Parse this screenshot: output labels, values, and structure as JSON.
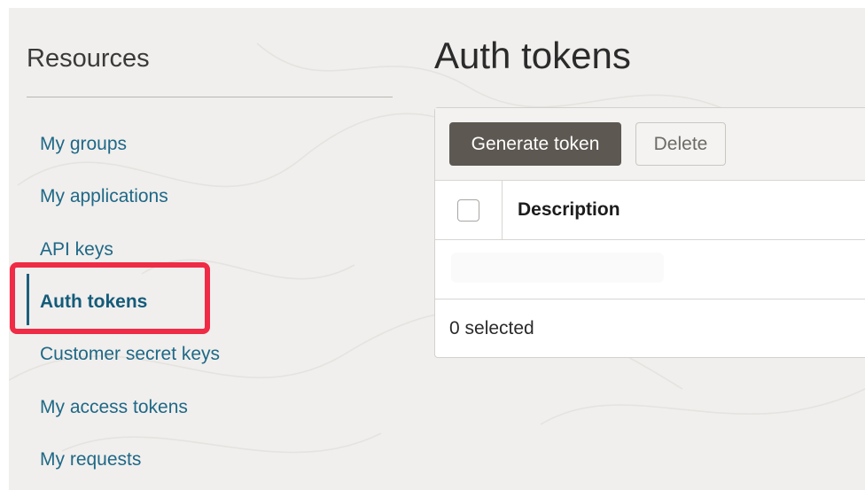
{
  "sidebar": {
    "title": "Resources",
    "items": [
      {
        "label": "My groups"
      },
      {
        "label": "My applications"
      },
      {
        "label": "API keys"
      },
      {
        "label": "Auth tokens",
        "active": true
      },
      {
        "label": "Customer secret keys"
      },
      {
        "label": "My access tokens"
      },
      {
        "label": "My requests"
      }
    ]
  },
  "main": {
    "title": "Auth tokens",
    "toolbar": {
      "generate_label": "Generate token",
      "delete_label": "Delete"
    },
    "table": {
      "columns": [
        "Description"
      ],
      "rows": []
    },
    "footer": {
      "selected_text": "0 selected"
    }
  },
  "colors": {
    "link": "#1f6887",
    "primary_button": "#5d5851",
    "highlight": "#ef2b46",
    "background": "#f0efed"
  }
}
